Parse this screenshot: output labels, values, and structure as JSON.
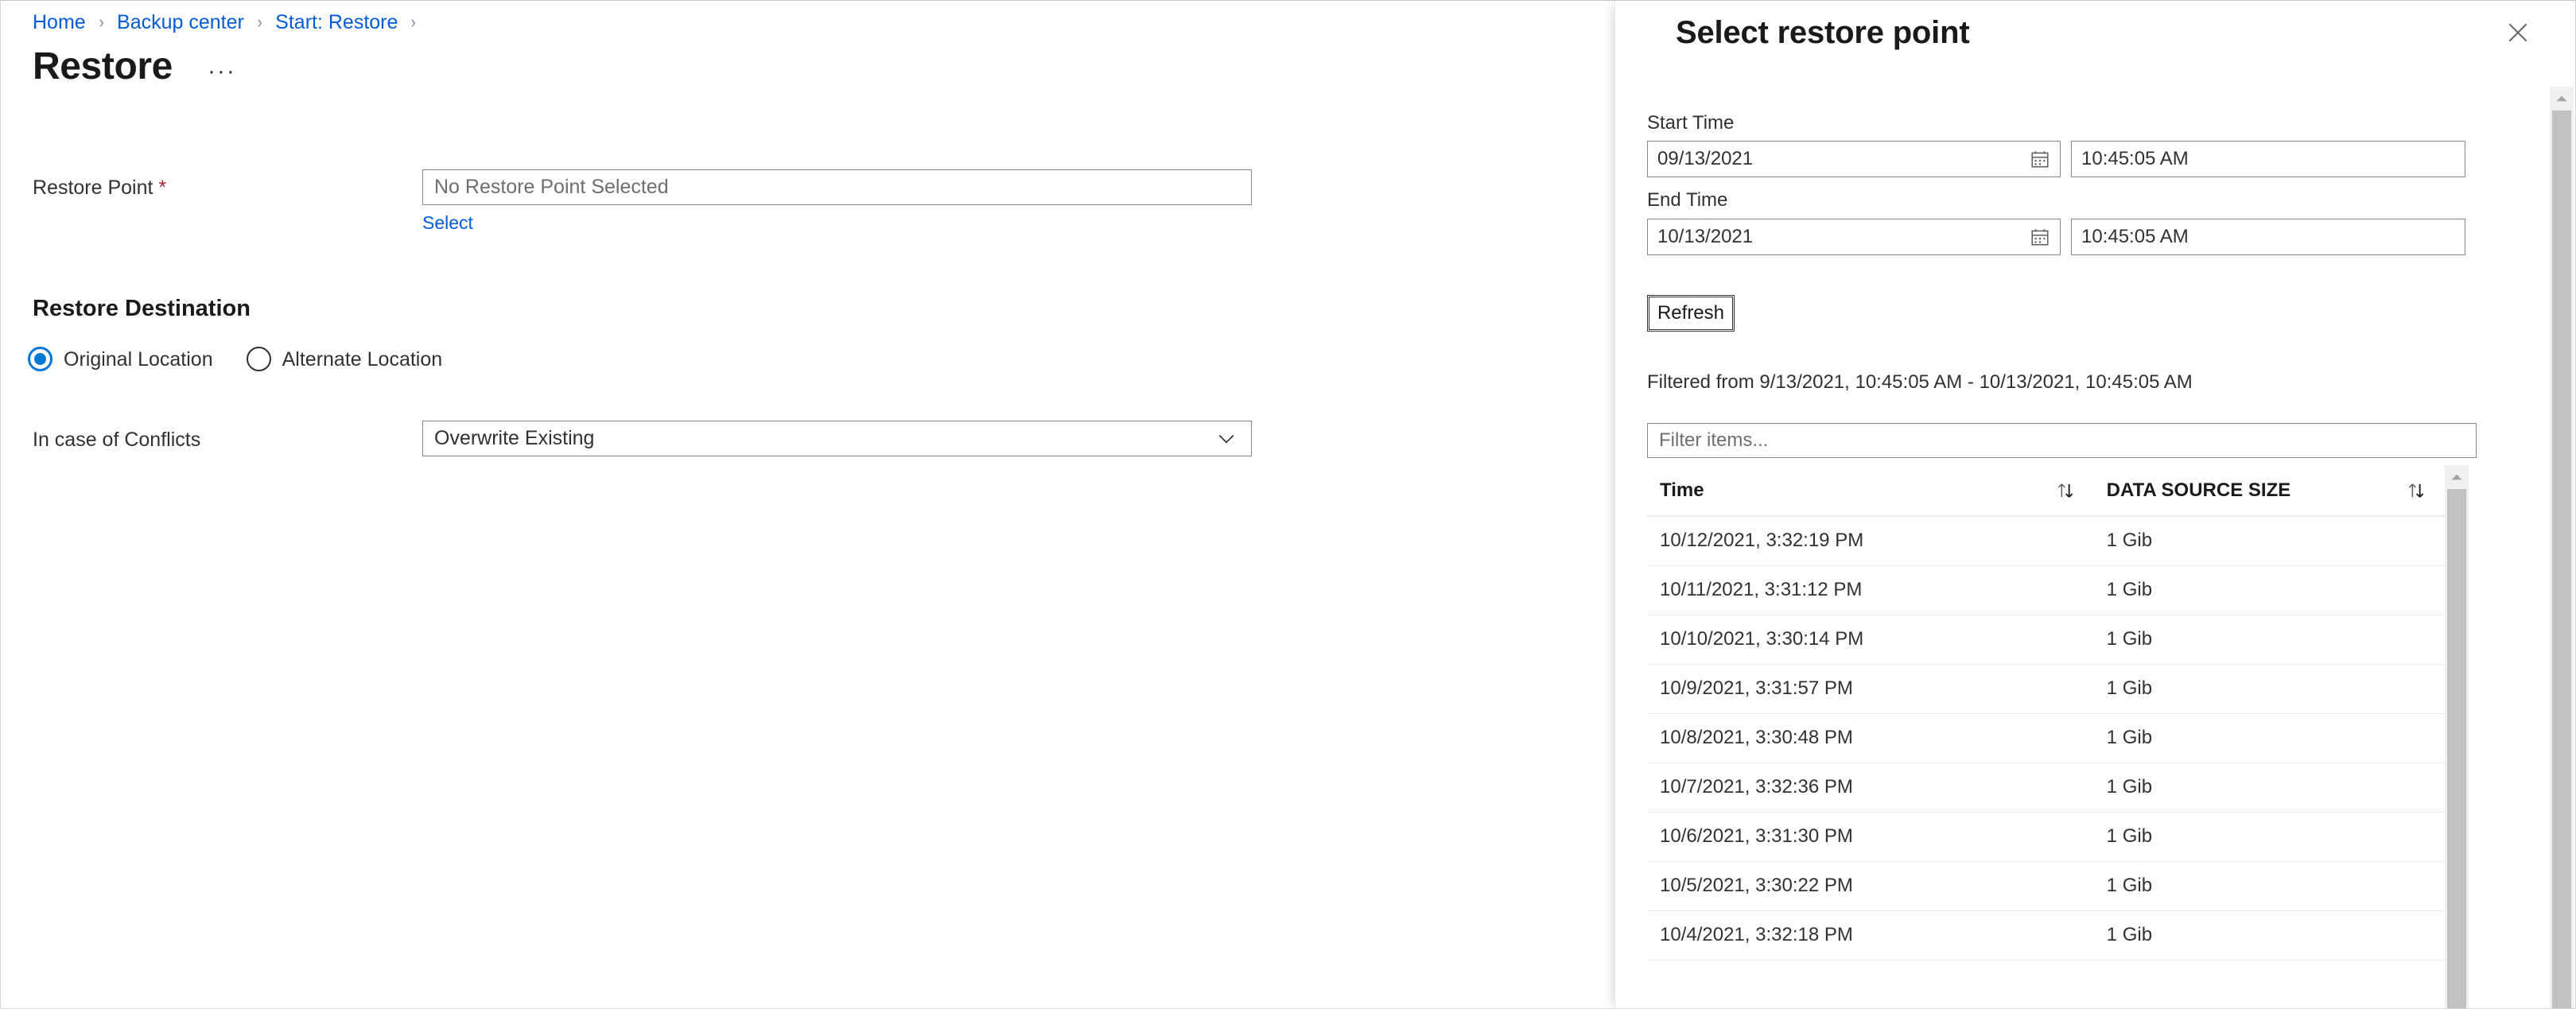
{
  "breadcrumb": {
    "items": [
      {
        "label": "Home"
      },
      {
        "label": "Backup center"
      },
      {
        "label": "Start: Restore"
      }
    ],
    "separator": "›"
  },
  "page": {
    "title": "Restore",
    "more_actions": "···"
  },
  "form": {
    "restore_point": {
      "label": "Restore Point",
      "required_mark": "*",
      "value": "No Restore Point Selected",
      "select_link": "Select"
    },
    "restore_destination": {
      "heading": "Restore Destination",
      "options": [
        {
          "label": "Original Location",
          "selected": true
        },
        {
          "label": "Alternate Location",
          "selected": false
        }
      ]
    },
    "conflicts": {
      "label": "In case of Conflicts",
      "selected_value": "Overwrite Existing",
      "chevron": "chevron-down-icon"
    }
  },
  "panel": {
    "title": "Select restore point",
    "close_label": "✕",
    "start_time": {
      "label": "Start Time",
      "date": "09/13/2021",
      "time": "10:45:05 AM"
    },
    "end_time": {
      "label": "End Time",
      "date": "10/13/2021",
      "time": "10:45:05 AM"
    },
    "refresh_button": "Refresh",
    "filtered_note": "Filtered from 9/13/2021, 10:45:05 AM - 10/13/2021, 10:45:05 AM",
    "filter_placeholder": "Filter items...",
    "table": {
      "columns": [
        {
          "label": "Time",
          "sort_icon": "sort-updown-icon"
        },
        {
          "label": "DATA SOURCE SIZE",
          "sort_icon": "sort-updown-icon"
        }
      ],
      "rows": [
        {
          "time": "10/12/2021, 3:32:19 PM",
          "size": "1  Gib"
        },
        {
          "time": "10/11/2021, 3:31:12 PM",
          "size": "1  Gib"
        },
        {
          "time": "10/10/2021, 3:30:14 PM",
          "size": "1  Gib"
        },
        {
          "time": "10/9/2021, 3:31:57 PM",
          "size": "1  Gib"
        },
        {
          "time": "10/8/2021, 3:30:48 PM",
          "size": "1  Gib"
        },
        {
          "time": "10/7/2021, 3:32:36 PM",
          "size": "1  Gib"
        },
        {
          "time": "10/6/2021, 3:31:30 PM",
          "size": "1  Gib"
        },
        {
          "time": "10/5/2021, 3:30:22 PM",
          "size": "1  Gib"
        },
        {
          "time": "10/4/2021, 3:32:18 PM",
          "size": "1  Gib"
        }
      ]
    }
  },
  "colors": {
    "accent": "#0078d4",
    "link": "#015cda",
    "required": "#a4262c",
    "text": "#323130",
    "border": "#8a8886"
  }
}
